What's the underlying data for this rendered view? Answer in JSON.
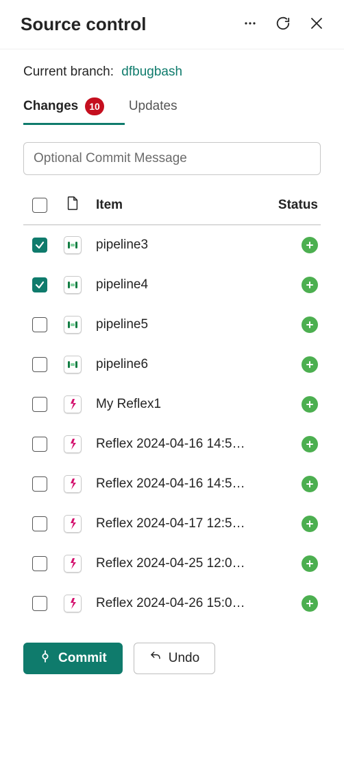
{
  "header": {
    "title": "Source control"
  },
  "branch": {
    "label": "Current branch:",
    "name": "dfbugbash"
  },
  "tabs": {
    "changes_label": "Changes",
    "changes_count": "10",
    "updates_label": "Updates"
  },
  "commit": {
    "placeholder": "Optional Commit Message"
  },
  "columns": {
    "item": "Item",
    "status": "Status"
  },
  "items": [
    {
      "name": "pipeline3",
      "type": "pipeline",
      "checked": true,
      "status": "added"
    },
    {
      "name": "pipeline4",
      "type": "pipeline",
      "checked": true,
      "status": "added"
    },
    {
      "name": "pipeline5",
      "type": "pipeline",
      "checked": false,
      "status": "added"
    },
    {
      "name": "pipeline6",
      "type": "pipeline",
      "checked": false,
      "status": "added"
    },
    {
      "name": "My Reflex1",
      "type": "reflex",
      "checked": false,
      "status": "added"
    },
    {
      "name": "Reflex 2024-04-16 14:5…",
      "type": "reflex",
      "checked": false,
      "status": "added"
    },
    {
      "name": "Reflex 2024-04-16 14:5…",
      "type": "reflex",
      "checked": false,
      "status": "added"
    },
    {
      "name": "Reflex 2024-04-17 12:5…",
      "type": "reflex",
      "checked": false,
      "status": "added"
    },
    {
      "name": "Reflex 2024-04-25 12:0…",
      "type": "reflex",
      "checked": false,
      "status": "added"
    },
    {
      "name": "Reflex 2024-04-26 15:0…",
      "type": "reflex",
      "checked": false,
      "status": "added"
    }
  ],
  "footer": {
    "commit_label": "Commit",
    "undo_label": "Undo"
  },
  "colors": {
    "accent": "#0f7b6c",
    "badge": "#c50f1f",
    "status_added": "#4caf50"
  }
}
